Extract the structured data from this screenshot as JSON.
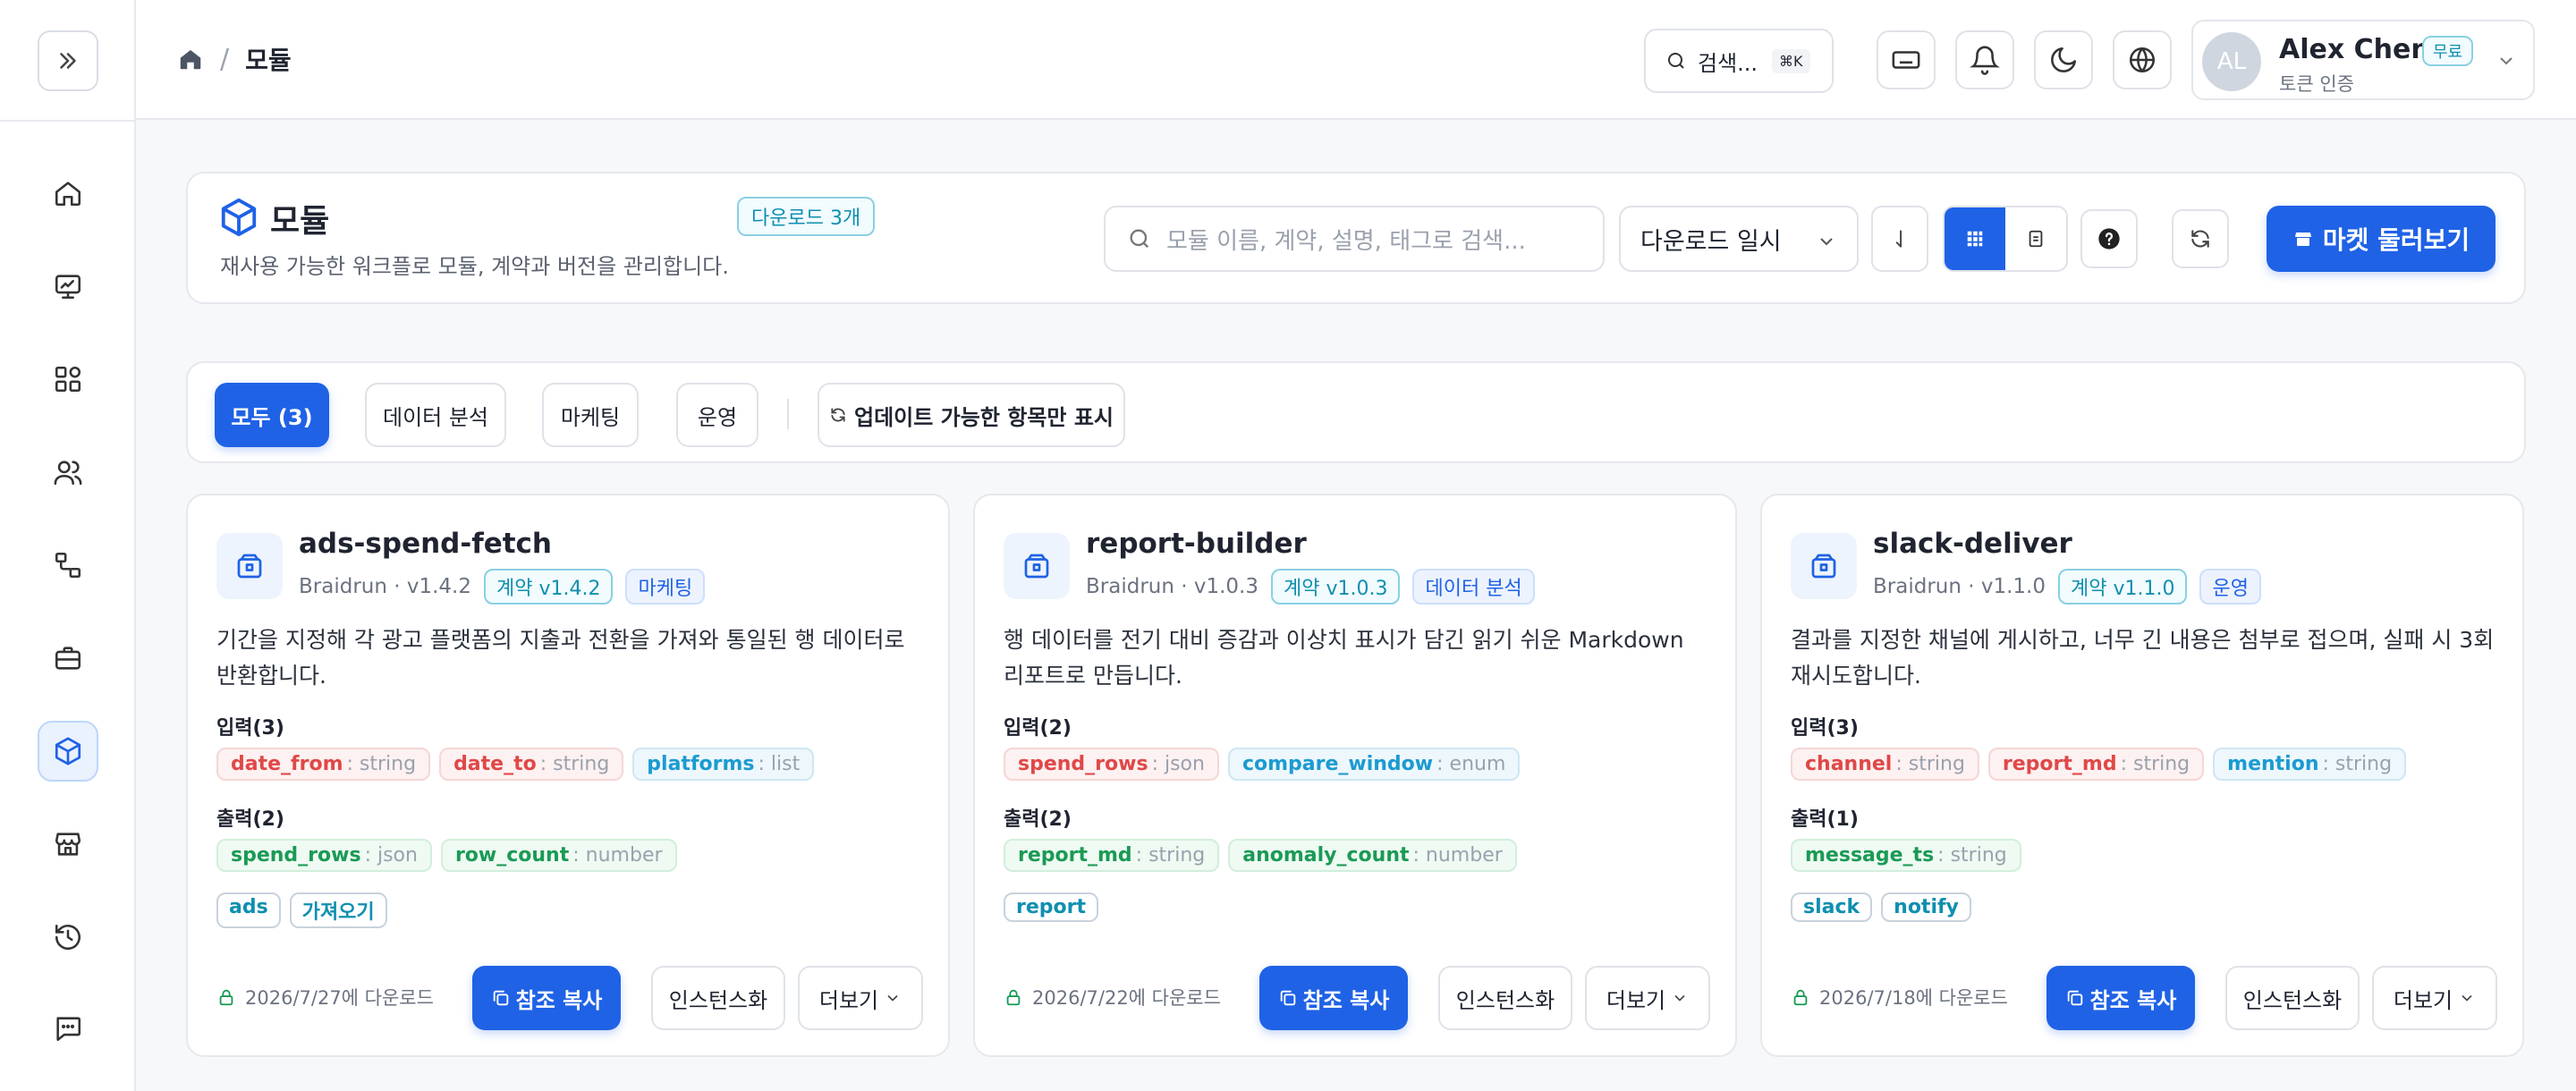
{
  "breadcrumb": {
    "current": "모듈"
  },
  "topbar": {
    "search_label": "검색...",
    "search_shortcut": "⌘K",
    "user": {
      "initials": "AL",
      "name": "Alex Chen",
      "plan": "무료",
      "auth": "토큰 인증"
    }
  },
  "header": {
    "title": "모듈",
    "download_badge": "다운로드 3개",
    "subtitle": "재사용 가능한 워크플로 모듈, 계약과 버전을 관리합니다.",
    "search_placeholder": "모듈 이름, 계약, 설명, 태그로 검색...",
    "sort_label": "다운로드 일시",
    "market_button": "마켓 둘러보기"
  },
  "filters": {
    "all": "모두 (3)",
    "data": "데이터 분석",
    "marketing": "마케팅",
    "ops": "운영",
    "updatable": "업데이트 가능한 항목만 표시"
  },
  "common": {
    "inputs_prefix": "입력",
    "outputs_prefix": "출력",
    "copy_ref": "참조 복사",
    "instantiate": "인스턴스화",
    "more": "더보기"
  },
  "cards": [
    {
      "name": "ads-spend-fetch",
      "meta": "Braidrun · v1.4.2",
      "contract": "계약 v1.4.2",
      "category": "마케팅",
      "desc": "기간을 지정해 각 광고 플랫폼의 지출과 전환을 가져와 통일된 행 데이터로 반환합니다.",
      "inputs_label": "입력(3)",
      "inputs": [
        {
          "name": "date_from",
          "type": ": string",
          "color": "red"
        },
        {
          "name": "date_to",
          "type": ": string",
          "color": "red"
        },
        {
          "name": "platforms",
          "type": ": list",
          "color": "blue"
        }
      ],
      "outputs_label": "출력(2)",
      "outputs": [
        {
          "name": "spend_rows",
          "type": ": json",
          "color": "green"
        },
        {
          "name": "row_count",
          "type": ": number",
          "color": "green"
        }
      ],
      "tags": [
        "ads",
        "가져오기"
      ],
      "date": "2026/7/27에 다운로드"
    },
    {
      "name": "report-builder",
      "meta": "Braidrun · v1.0.3",
      "contract": "계약 v1.0.3",
      "category": "데이터 분석",
      "desc": "행 데이터를 전기 대비 증감과 이상치 표시가 담긴 읽기 쉬운 Markdown 리포트로 만듭니다.",
      "inputs_label": "입력(2)",
      "inputs": [
        {
          "name": "spend_rows",
          "type": ": json",
          "color": "red"
        },
        {
          "name": "compare_window",
          "type": ": enum",
          "color": "blue"
        }
      ],
      "outputs_label": "출력(2)",
      "outputs": [
        {
          "name": "report_md",
          "type": ": string",
          "color": "green"
        },
        {
          "name": "anomaly_count",
          "type": ": number",
          "color": "green"
        }
      ],
      "tags": [
        "report"
      ],
      "date": "2026/7/22에 다운로드"
    },
    {
      "name": "slack-deliver",
      "meta": "Braidrun · v1.1.0",
      "contract": "계약 v1.1.0",
      "category": "운영",
      "desc": "결과를 지정한 채널에 게시하고, 너무 긴 내용은 첨부로 접으며, 실패 시 3회 재시도합니다.",
      "inputs_label": "입력(3)",
      "inputs": [
        {
          "name": "channel",
          "type": ": string",
          "color": "red"
        },
        {
          "name": "report_md",
          "type": ": string",
          "color": "red"
        },
        {
          "name": "mention",
          "type": ": string",
          "color": "blue"
        }
      ],
      "outputs_label": "출력(1)",
      "outputs": [
        {
          "name": "message_ts",
          "type": ": string",
          "color": "green"
        }
      ],
      "tags": [
        "slack",
        "notify"
      ],
      "date": "2026/7/18에 다운로드"
    }
  ]
}
